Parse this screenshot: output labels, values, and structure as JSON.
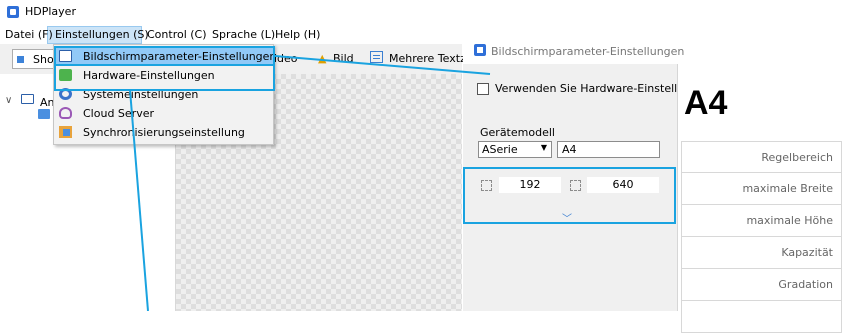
{
  "app": {
    "title": "HDPlayer"
  },
  "menubar": [
    {
      "label": "Datei (F)"
    },
    {
      "label": "Einstellungen (S)"
    },
    {
      "label": "Control (C)"
    },
    {
      "label": "Sprache (L)"
    },
    {
      "label": "Help (H)"
    }
  ],
  "toolbar": {
    "show_label": "Sho",
    "video_label": "ideo",
    "bild_label": "Bild",
    "text_label": "Mehrere Textz"
  },
  "tree": {
    "root_label": "An"
  },
  "dropdown": {
    "items": [
      {
        "label": "Bildschirmparameter-Einstellungen",
        "icon": "monitor-icon",
        "highlighted": true
      },
      {
        "label": "Hardware-Einstellungen",
        "icon": "hardware-icon"
      },
      {
        "label": "Systemeinstellungen",
        "icon": "gear-icon"
      },
      {
        "label": "Cloud Server",
        "icon": "cloud-icon"
      },
      {
        "label": "Synchronisierungseinstellung",
        "icon": "sync-icon"
      }
    ]
  },
  "dialog": {
    "title": "Bildschirmparameter-Einstellungen",
    "hardware_checkbox": {
      "label": "Verwenden Sie Hardware-Einstell",
      "checked": false
    },
    "model_label": "Gerätemodell",
    "series_value": "ASerie",
    "model_value": "A4",
    "width_value": "192",
    "height_value": "640",
    "model_big": "A4",
    "params": [
      {
        "label": "Regelbereich"
      },
      {
        "label": "maximale Breite"
      },
      {
        "label": "maximale Höhe"
      },
      {
        "label": "Kapazität"
      },
      {
        "label": "Gradation"
      },
      {
        "label": ""
      }
    ]
  },
  "colors": {
    "highlight": "#1aa3e0",
    "menu_selected": "#91c9f7",
    "accent": "#2f6fd8"
  }
}
